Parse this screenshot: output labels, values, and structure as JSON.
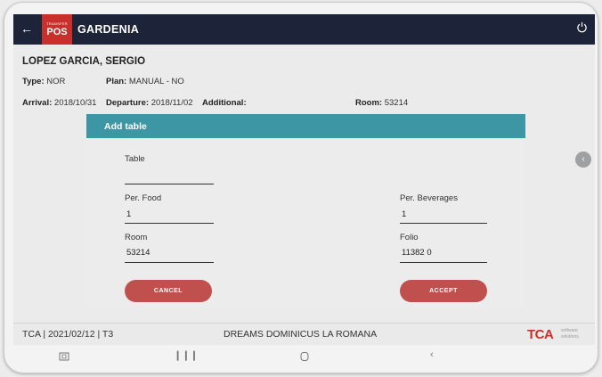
{
  "app": {
    "logo_small": "TRANSFER",
    "logo_big": "POS",
    "title": "GARDENIA"
  },
  "guest": {
    "name": "LOPEZ GARCIA, SERGIO",
    "type_label": "Type:",
    "type_value": "NOR",
    "plan_label": "Plan:",
    "plan_value": "MANUAL - NO",
    "arrival_label": "Arrival:",
    "arrival_value": "2018/10/31",
    "departure_label": "Departure:",
    "departure_value": "2018/11/02",
    "additional_label": "Additional:",
    "room_label": "Room:",
    "room_value": "53214"
  },
  "modal": {
    "title": "Add table",
    "table_label": "Table",
    "table_value": "",
    "food_label": "Per. Food",
    "food_value": "1",
    "beverages_label": "Per. Beverages",
    "beverages_value": "1",
    "room_label": "Room",
    "room_value": "53214",
    "folio_label": "Folio",
    "folio_value": "11382 0",
    "cancel_label": "CANCEL",
    "accept_label": "ACCEPT"
  },
  "footer": {
    "left": "TCA | 2021/02/12 | T3",
    "center": "DREAMS DOMINICUS LA ROMANA",
    "logo": "TCA",
    "logo_sub1": "software",
    "logo_sub2": "solutions"
  },
  "icons": {
    "back": "arrow-left-icon",
    "power": "power-icon",
    "handle": "chevron-left-icon",
    "nav_screenshot": "screenshot-icon",
    "nav_recents": "recents-icon",
    "nav_home": "home-icon",
    "nav_back": "back-icon"
  },
  "colors": {
    "topbar": "#1d2338",
    "logo": "#c9302c",
    "modal_header": "#3d96a3",
    "button": "#c0504d"
  }
}
